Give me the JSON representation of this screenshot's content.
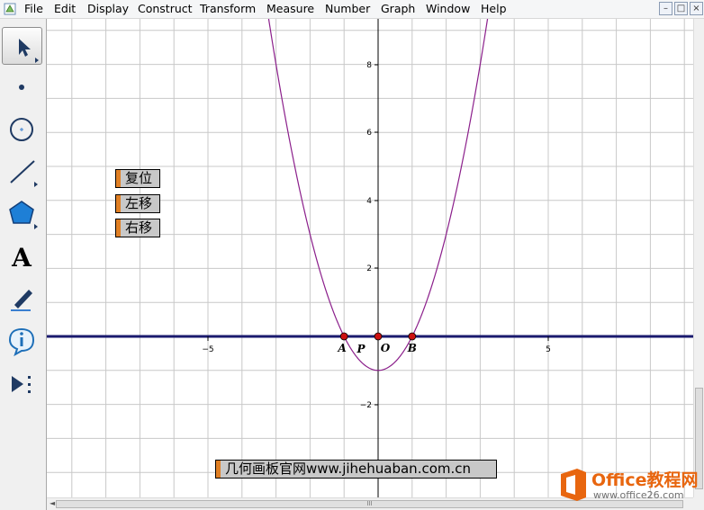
{
  "menu": {
    "items": [
      "File",
      "Edit",
      "Display",
      "Construct",
      "Transform",
      "Measure",
      "Number",
      "Graph",
      "Window",
      "Help"
    ]
  },
  "window_controls": {
    "minimize": "–",
    "restore": "□",
    "close": "×"
  },
  "toolbox": {
    "tools": [
      {
        "name": "arrow-select-tool",
        "icon": "arrow-icon"
      },
      {
        "name": "point-tool",
        "icon": "point-icon"
      },
      {
        "name": "compass-tool",
        "icon": "circle-icon"
      },
      {
        "name": "straightedge-tool",
        "icon": "line-icon"
      },
      {
        "name": "polygon-tool",
        "icon": "pentagon-icon"
      },
      {
        "name": "text-tool",
        "icon": "text-A-icon"
      },
      {
        "name": "marker-tool",
        "icon": "pen-icon"
      },
      {
        "name": "information-tool",
        "icon": "info-icon"
      },
      {
        "name": "custom-tool",
        "icon": "play-dots-icon"
      }
    ],
    "text_tool_glyph": "A"
  },
  "buttons": {
    "reset": "复位",
    "move_left": "左移",
    "move_right": "右移",
    "site": "几何画板官网www.jihehuaban.com.cn"
  },
  "graph": {
    "x_ticks": [
      "−5",
      "5"
    ],
    "y_ticks": [
      "8",
      "6",
      "4",
      "2",
      "−2"
    ],
    "points": [
      {
        "label": "A",
        "x": -1,
        "y": 0
      },
      {
        "label": "O",
        "x": 0,
        "y": 0
      },
      {
        "label": "B",
        "x": 1,
        "y": 0
      }
    ],
    "extra_labels": [
      "P"
    ],
    "curve_color": "#8b1f8b",
    "x_axis_color": "#1a1a6e",
    "point_color": "#cc1111"
  },
  "watermark": {
    "brand": "Office教程网",
    "url": "www.office26.com"
  },
  "scrollbar": {
    "thumb_grip": "III"
  }
}
